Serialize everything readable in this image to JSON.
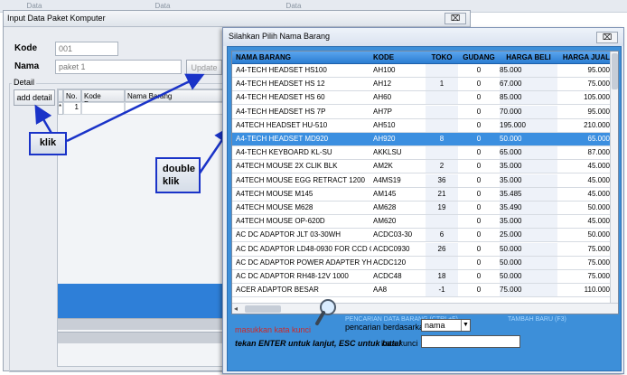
{
  "background": {
    "col1": "Data",
    "col2": "Data",
    "col3": "Data"
  },
  "form": {
    "title": "Input Data Paket Komputer",
    "close_label": "⌧",
    "kode_label": "Kode",
    "kode_value": "001",
    "nama_label": "Nama",
    "nama_value": "paket 1",
    "update_label": "Update",
    "detail_label": "Detail",
    "add_detail_label": "add detail",
    "grid_headers": {
      "no": "No.",
      "kode": "Kode Barang",
      "nama": "Nama Barang"
    },
    "grid_row": {
      "marker": "*",
      "no": "1"
    }
  },
  "callouts": {
    "klik": "klik",
    "double_klik": "double\nklik"
  },
  "dialog": {
    "title": "Silahkan Pilih Nama Barang",
    "close_label": "⌧",
    "headers": {
      "nama": "NAMA BARANG",
      "kode": "KODE",
      "toko": "TOKO",
      "gudang": "GUDANG",
      "beli": "HARGA BELI",
      "jual": "HARGA JUAL"
    },
    "rows": [
      {
        "nama": "A4-TECH  HEADSET HS100",
        "kode": "AH100",
        "toko": "",
        "gudang": "0",
        "beli": "85.000",
        "jual": "95.000"
      },
      {
        "nama": "A4-TECH HEADSET HS 12",
        "kode": "AH12",
        "toko": "1",
        "gudang": "0",
        "beli": "67.000",
        "jual": "75.000"
      },
      {
        "nama": "A4-TECH HEADSET HS 60",
        "kode": "AH60",
        "toko": "",
        "gudang": "0",
        "beli": "85.000",
        "jual": "105.000"
      },
      {
        "nama": "A4-TECH HEADSET HS 7P",
        "kode": "AH7P",
        "toko": "",
        "gudang": "0",
        "beli": "70.000",
        "jual": "95.000"
      },
      {
        "nama": "A4TECH HEADSET HU-510",
        "kode": "AH510",
        "toko": "",
        "gudang": "0",
        "beli": "195.000",
        "jual": "210.000"
      },
      {
        "nama": "A4-TECH HEADSET MD920",
        "kode": "AH920",
        "toko": "8",
        "gudang": "0",
        "beli": "50.000",
        "jual": "65.000"
      },
      {
        "nama": "A4-TECH KEYBOARD KL-SU",
        "kode": "AKKLSU",
        "toko": "",
        "gudang": "0",
        "beli": "65.000",
        "jual": "87.000"
      },
      {
        "nama": "A4TECH MOUSE 2X CLIK BLK",
        "kode": "AM2K",
        "toko": "2",
        "gudang": "0",
        "beli": "35.000",
        "jual": "45.000"
      },
      {
        "nama": "A4TECH MOUSE EGG RETRACT 1200",
        "kode": "A4MS19",
        "toko": "36",
        "gudang": "0",
        "beli": "35.000",
        "jual": "45.000"
      },
      {
        "nama": "A4TECH MOUSE M145",
        "kode": "AM145",
        "toko": "21",
        "gudang": "0",
        "beli": "35.485",
        "jual": "45.000"
      },
      {
        "nama": "A4TECH MOUSE M628",
        "kode": "AM628",
        "toko": "19",
        "gudang": "0",
        "beli": "35.490",
        "jual": "50.000"
      },
      {
        "nama": "A4TECH MOUSE OP-620D",
        "kode": "AM620",
        "toko": "",
        "gudang": "0",
        "beli": "35.000",
        "jual": "45.000"
      },
      {
        "nama": "AC DC ADAPTOR JLT 03-30WH",
        "kode": "ACDC03-30",
        "toko": "6",
        "gudang": "0",
        "beli": "25.000",
        "jual": "50.000"
      },
      {
        "nama": "AC DC ADAPTOR LD48-0930 FOR CCD CAMERA",
        "kode": "ACDC0930",
        "toko": "26",
        "gudang": "0",
        "beli": "50.000",
        "jual": "75.000"
      },
      {
        "nama": "AC DC ADAPTOR POWER ADAPTER YHD-0600800V",
        "kode": "ACDC120",
        "toko": "",
        "gudang": "0",
        "beli": "50.000",
        "jual": "75.000"
      },
      {
        "nama": "AC DC ADAPTOR RH48-12V 1000",
        "kode": "ACDC48",
        "toko": "18",
        "gudang": "0",
        "beli": "50.000",
        "jual": "75.000"
      },
      {
        "nama": "ACER ADAPTOR BESAR",
        "kode": "AA8",
        "toko": "-1",
        "gudang": "0",
        "beli": "75.000",
        "jual": "110.000"
      }
    ],
    "search_caption": "PENCARIAN DATA BARANG (CTRL+F)",
    "new_caption": "TAMBAH BARU (F3)",
    "hint1": "masukkan kata kunci",
    "search_by_label": "pencarian berdasarkan",
    "search_by_value": "nama",
    "hint2": "tekan ENTER untuk lanjut, ESC untuk batal",
    "keyword_label": "kata kunci",
    "keyword_value": ""
  },
  "colors": {
    "dialog_bg": "#3d8fd9",
    "selection": "#3b8fe0",
    "callout_border": "#1a33c8"
  }
}
